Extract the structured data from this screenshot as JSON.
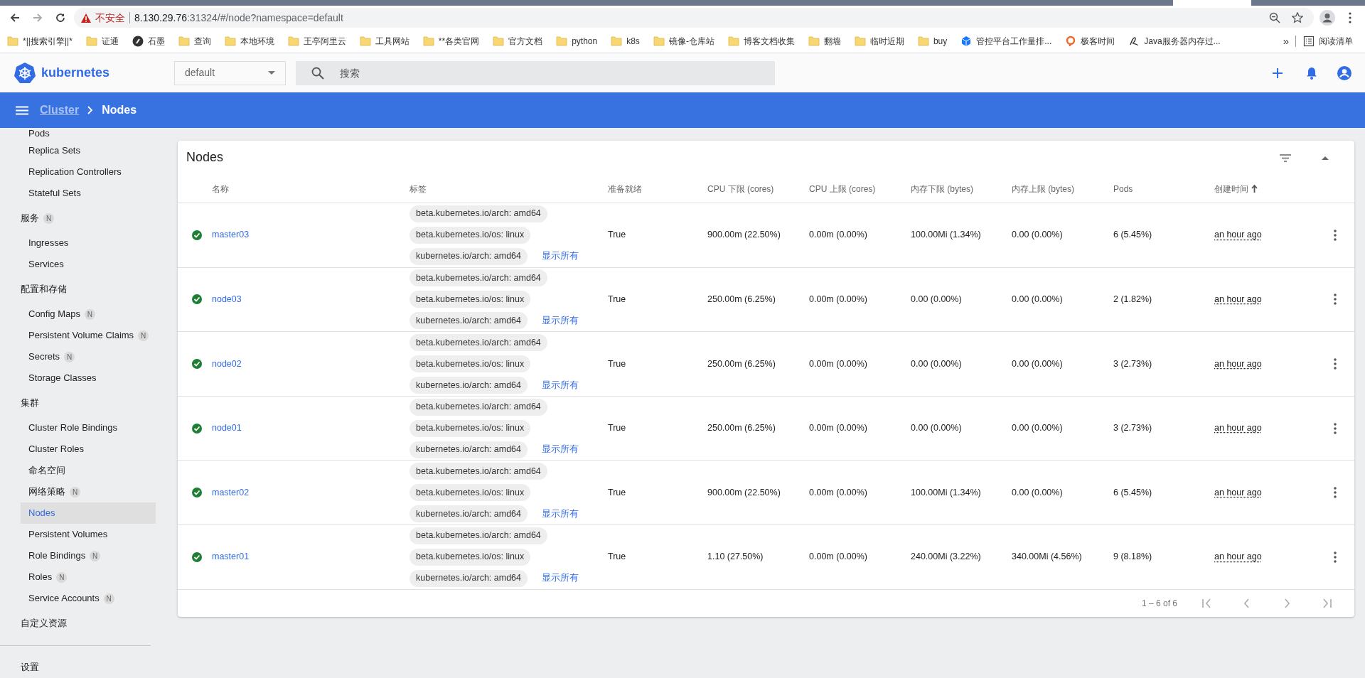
{
  "browser": {
    "url": {
      "warning": "不安全",
      "host": "8.130.29.76",
      "path": ":31324/#/node?namespace=default"
    },
    "bookmarks": [
      {
        "label": "*||搜索引擎||*",
        "kind": "folder"
      },
      {
        "label": "证通",
        "kind": "folder"
      },
      {
        "label": "石墨",
        "kind": "site"
      },
      {
        "label": "查询",
        "kind": "folder"
      },
      {
        "label": "本地环境",
        "kind": "folder"
      },
      {
        "label": "王亭阿里云",
        "kind": "folder"
      },
      {
        "label": "工具网站",
        "kind": "folder"
      },
      {
        "label": "**各类官网",
        "kind": "folder"
      },
      {
        "label": "官方文档",
        "kind": "folder"
      },
      {
        "label": "python",
        "kind": "folder"
      },
      {
        "label": "k8s",
        "kind": "folder"
      },
      {
        "label": "镜像-仓库站",
        "kind": "folder"
      },
      {
        "label": "博客文档收集",
        "kind": "folder"
      },
      {
        "label": "翻墙",
        "kind": "folder"
      },
      {
        "label": "临时近期",
        "kind": "folder"
      },
      {
        "label": "buy",
        "kind": "folder"
      },
      {
        "label": "管控平台工作量排...",
        "kind": "cube"
      },
      {
        "label": "极客时间",
        "kind": "geek"
      },
      {
        "label": "Java服务器内存过...",
        "kind": "script"
      }
    ],
    "more": "»",
    "reading_list": "阅读清单"
  },
  "header": {
    "logo": "kubernetes",
    "namespace": "default",
    "search": {
      "placeholder": "搜索"
    }
  },
  "breadcrumb": [
    {
      "label": "Cluster",
      "current": false
    },
    {
      "label": "Nodes",
      "current": true
    }
  ],
  "sidebar": {
    "items": [
      {
        "label": "Pods",
        "kind": "item",
        "selected": false
      },
      {
        "label": "Replica Sets",
        "kind": "item",
        "selected": false
      },
      {
        "label": "Replication Controllers",
        "kind": "item",
        "selected": false
      },
      {
        "label": "Stateful Sets",
        "kind": "item",
        "selected": false
      },
      {
        "label": "服务",
        "kind": "section",
        "badge": "N"
      },
      {
        "label": "Ingresses",
        "kind": "item",
        "selected": false
      },
      {
        "label": "Services",
        "kind": "item",
        "selected": false
      },
      {
        "label": "配置和存储",
        "kind": "section"
      },
      {
        "label": "Config Maps",
        "kind": "item",
        "badge": "N",
        "selected": false
      },
      {
        "label": "Persistent Volume Claims",
        "kind": "item",
        "badge": "N",
        "selected": false
      },
      {
        "label": "Secrets",
        "kind": "item",
        "badge": "N",
        "selected": false
      },
      {
        "label": "Storage Classes",
        "kind": "item",
        "selected": false
      },
      {
        "label": "集群",
        "kind": "section"
      },
      {
        "label": "Cluster Role Bindings",
        "kind": "item",
        "selected": false
      },
      {
        "label": "Cluster Roles",
        "kind": "item",
        "selected": false
      },
      {
        "label": "命名空间",
        "kind": "item",
        "selected": false
      },
      {
        "label": "网络策略",
        "kind": "item",
        "badge": "N",
        "selected": false
      },
      {
        "label": "Nodes",
        "kind": "item",
        "selected": true
      },
      {
        "label": "Persistent Volumes",
        "kind": "item",
        "selected": false
      },
      {
        "label": "Role Bindings",
        "kind": "item",
        "badge": "N",
        "selected": false
      },
      {
        "label": "Roles",
        "kind": "item",
        "badge": "N",
        "selected": false
      },
      {
        "label": "Service Accounts",
        "kind": "item",
        "badge": "N",
        "selected": false
      },
      {
        "label": "自定义资源",
        "kind": "section"
      },
      {
        "kind": "divider"
      },
      {
        "label": "设置",
        "kind": "section"
      }
    ]
  },
  "table": {
    "title": "Nodes",
    "columns": [
      {
        "label": "名称",
        "sorted": false
      },
      {
        "label": "标签",
        "sorted": false
      },
      {
        "label": "准备就绪",
        "sorted": false
      },
      {
        "label": "CPU 下限 (cores)",
        "sorted": false
      },
      {
        "label": "CPU 上限 (cores)",
        "sorted": false
      },
      {
        "label": "内存下限 (bytes)",
        "sorted": false
      },
      {
        "label": "内存上限 (bytes)",
        "sorted": false
      },
      {
        "label": "Pods",
        "sorted": false
      },
      {
        "label": "创建时间",
        "sorted": true
      }
    ],
    "rows": [
      {
        "healthy": true,
        "name": "master03",
        "labels": [
          "beta.kubernetes.io/arch: amd64",
          "beta.kubernetes.io/os: linux",
          "kubernetes.io/arch: amd64"
        ],
        "show_all": "显示所有",
        "ready": "True",
        "cpu_requests": "900.00m (22.50%)",
        "cpu_limits": "0.00m (0.00%)",
        "memory_requests": "100.00Mi (1.34%)",
        "memory_limits": "0.00 (0.00%)",
        "pods": "6 (5.45%)",
        "created": "an hour ago"
      },
      {
        "healthy": true,
        "name": "node03",
        "labels": [
          "beta.kubernetes.io/arch: amd64",
          "beta.kubernetes.io/os: linux",
          "kubernetes.io/arch: amd64"
        ],
        "show_all": "显示所有",
        "ready": "True",
        "cpu_requests": "250.00m (6.25%)",
        "cpu_limits": "0.00m (0.00%)",
        "memory_requests": "0.00 (0.00%)",
        "memory_limits": "0.00 (0.00%)",
        "pods": "2 (1.82%)",
        "created": "an hour ago"
      },
      {
        "healthy": true,
        "name": "node02",
        "labels": [
          "beta.kubernetes.io/arch: amd64",
          "beta.kubernetes.io/os: linux",
          "kubernetes.io/arch: amd64"
        ],
        "show_all": "显示所有",
        "ready": "True",
        "cpu_requests": "250.00m (6.25%)",
        "cpu_limits": "0.00m (0.00%)",
        "memory_requests": "0.00 (0.00%)",
        "memory_limits": "0.00 (0.00%)",
        "pods": "3 (2.73%)",
        "created": "an hour ago"
      },
      {
        "healthy": true,
        "name": "node01",
        "labels": [
          "beta.kubernetes.io/arch: amd64",
          "beta.kubernetes.io/os: linux",
          "kubernetes.io/arch: amd64"
        ],
        "show_all": "显示所有",
        "ready": "True",
        "cpu_requests": "250.00m (6.25%)",
        "cpu_limits": "0.00m (0.00%)",
        "memory_requests": "0.00 (0.00%)",
        "memory_limits": "0.00 (0.00%)",
        "pods": "3 (2.73%)",
        "created": "an hour ago"
      },
      {
        "healthy": true,
        "name": "master02",
        "labels": [
          "beta.kubernetes.io/arch: amd64",
          "beta.kubernetes.io/os: linux",
          "kubernetes.io/arch: amd64"
        ],
        "show_all": "显示所有",
        "ready": "True",
        "cpu_requests": "900.00m (22.50%)",
        "cpu_limits": "0.00m (0.00%)",
        "memory_requests": "100.00Mi (1.34%)",
        "memory_limits": "0.00 (0.00%)",
        "pods": "6 (5.45%)",
        "created": "an hour ago"
      },
      {
        "healthy": true,
        "name": "master01",
        "labels": [
          "beta.kubernetes.io/arch: amd64",
          "beta.kubernetes.io/os: linux",
          "kubernetes.io/arch: amd64"
        ],
        "show_all": "显示所有",
        "ready": "True",
        "cpu_requests": "1.10 (27.50%)",
        "cpu_limits": "0.00m (0.00%)",
        "memory_requests": "240.00Mi (3.22%)",
        "memory_limits": "340.00Mi (4.56%)",
        "pods": "9 (8.18%)",
        "created": "an hour ago"
      }
    ],
    "pagination": {
      "range": "1 – 6 of 6",
      "buttons": [
        {
          "kind": "first",
          "disabled": true
        },
        {
          "kind": "prev",
          "disabled": true
        },
        {
          "kind": "next",
          "disabled": true
        },
        {
          "kind": "last",
          "disabled": true
        }
      ]
    }
  }
}
